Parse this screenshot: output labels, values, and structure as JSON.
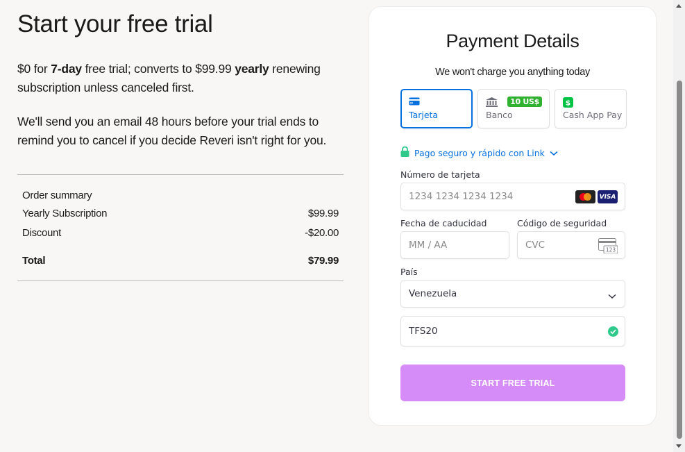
{
  "left": {
    "title": "Start your free trial",
    "intro": {
      "p1_a": "$0 for ",
      "p1_b": "7-day",
      "p1_c": " free trial; converts to $99.99 ",
      "p1_d": "yearly",
      "p1_e": " renewing subscription unless canceled first."
    },
    "notice": "We'll send you an email 48 hours before your trial ends to remind you to cancel if you decide Reveri isn't right for you.",
    "order_summary": {
      "heading": "Order summary",
      "rows": [
        {
          "label": "Yearly Subscription",
          "value": "$99.99"
        },
        {
          "label": "Discount",
          "value": "-$20.00"
        }
      ],
      "total_label": "Total",
      "total_value": "$79.99"
    }
  },
  "card": {
    "title": "Payment Details",
    "subtitle": "We won't charge you anything today",
    "methods": [
      {
        "label": "Tarjeta",
        "icon": "card-icon",
        "selected": true
      },
      {
        "label": "Banco",
        "icon": "bank-icon",
        "badge": "10 US$"
      },
      {
        "label": "Cash App Pay",
        "icon": "cash-app-icon"
      }
    ],
    "link_text": "Pago seguro y rápido con Link",
    "card_number": {
      "label": "Número de tarjeta",
      "placeholder": "1234 1234 1234 1234",
      "brands": [
        "mastercard",
        "visa"
      ],
      "visa_text": "VISA"
    },
    "expiry": {
      "label": "Fecha de caducidad",
      "placeholder": "MM / AA"
    },
    "cvc": {
      "label": "Código de seguridad",
      "placeholder": "CVC",
      "icon_text": "123"
    },
    "country": {
      "label": "País",
      "value": "Venezuela"
    },
    "promo": {
      "value": "TFS20",
      "valid": true
    },
    "submit_label": "START FREE TRIAL",
    "colors": {
      "accent": "#0570de",
      "submit": "#d58cf8",
      "badge": "#30b130",
      "valid": "#2fc98b"
    }
  }
}
